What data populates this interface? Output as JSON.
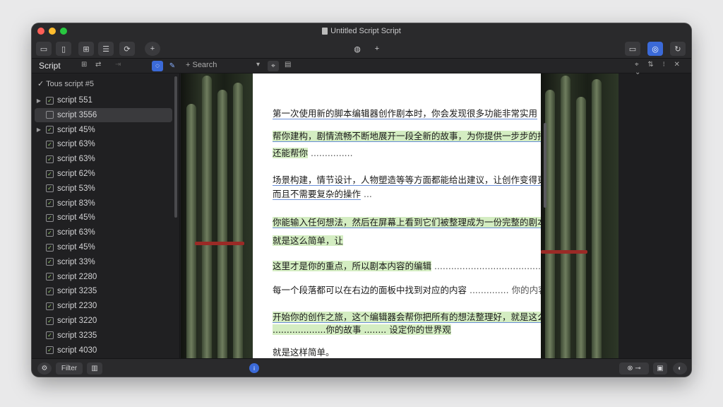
{
  "window": {
    "title": "Untitled Script Script",
    "traffic_colors": [
      "#ff5f57",
      "#febc2e",
      "#28c840"
    ]
  },
  "toolbar": {
    "left_icons": [
      "sidebar-icon",
      "document-icon",
      "layout-icon",
      "list-icon",
      "refresh-icon",
      "plus-icon"
    ],
    "center_icons": [
      "waveform-icon",
      "plus-icon"
    ],
    "right_icons": [
      "window-icon",
      "share-icon",
      "reload-icon"
    ]
  },
  "tabbar": {
    "script_label": "Script",
    "tab_label": "+ Search",
    "right_glyphs": "⌖ ⇅ ⁝ ✕ ⌄"
  },
  "sidebar": {
    "header": "Tous script #5",
    "items": [
      {
        "label": "script 551",
        "chevron": true,
        "check": true
      },
      {
        "label": "script 3556",
        "chevron": false,
        "check": false,
        "selected": true
      },
      {
        "label": "script 45%",
        "chevron": true,
        "check": true
      },
      {
        "label": "script 63%",
        "chevron": false,
        "check": true
      },
      {
        "label": "script 63%",
        "chevron": false,
        "check": true
      },
      {
        "label": "script 62%",
        "chevron": false,
        "check": true
      },
      {
        "label": "script 53%",
        "chevron": false,
        "check": true
      },
      {
        "label": "script 83%",
        "chevron": false,
        "check": true
      },
      {
        "label": "script 45%",
        "chevron": false,
        "check": true
      },
      {
        "label": "script 63%",
        "chevron": false,
        "check": true
      },
      {
        "label": "script 45%",
        "chevron": false,
        "check": true
      },
      {
        "label": "script 33%",
        "chevron": false,
        "check": true
      },
      {
        "label": "script 2280",
        "chevron": false,
        "check": true
      },
      {
        "label": "script 3235",
        "chevron": false,
        "check": true
      },
      {
        "label": "script 2230",
        "chevron": false,
        "check": true
      },
      {
        "label": "script 3220",
        "chevron": false,
        "check": true
      },
      {
        "label": "script 3235",
        "chevron": false,
        "check": true
      },
      {
        "label": "script 4030",
        "chevron": false,
        "check": true
      }
    ]
  },
  "document": {
    "lines": [
      {
        "text": "第一次使用新的脚本编辑器创作剧本时，你会发现很多功能非常实用",
        "tail": " ..................................."
      },
      {
        "text": "帮你建构，剧情流畅不断地展开一段全新的故事，为你提供一步步的指导。",
        "tail": ""
      },
      {
        "text": "还能帮你",
        "tail": " ..............."
      },
      {
        "text": "场景构建，情节设计，人物塑造等等方面都能给出建议，让创作变得更加简单",
        "tail": ""
      },
      {
        "text": "而且不需要复杂的操作",
        "tail": " ..."
      },
      {
        "text": "你能输入任何想法，然后在屏幕上看到它们被整理成为一份完整的剧本。",
        "tail": ""
      },
      {
        "text": "就是这么简单，让",
        "tail": ""
      },
      {
        "text": "这里才是你的重点，所以剧本内容的编辑",
        "tail": " ......................................."
      },
      {
        "text": "每一个段落都可以在右边的面板中找到对应的内容",
        "tail": " .............. 你的内容 ......................"
      },
      {
        "text": "开始你的创作之旅，这个编辑器会帮你把所有的想法整理好，就是这么简单，给你",
        "tail": ""
      },
      {
        "text": "...................你的故事 ........ 设定你的世界观",
        "tail": ""
      },
      {
        "text": "就是这样简单。",
        "tail": ""
      }
    ]
  },
  "statusbar": {
    "left_label": "Filter",
    "right_icons": [
      "link-icon",
      "panel-icon",
      "info-icon"
    ]
  },
  "colors": {
    "highlight": "#d4edc2",
    "accent": "#3b6ad8",
    "underline": "#6a8fd8"
  }
}
